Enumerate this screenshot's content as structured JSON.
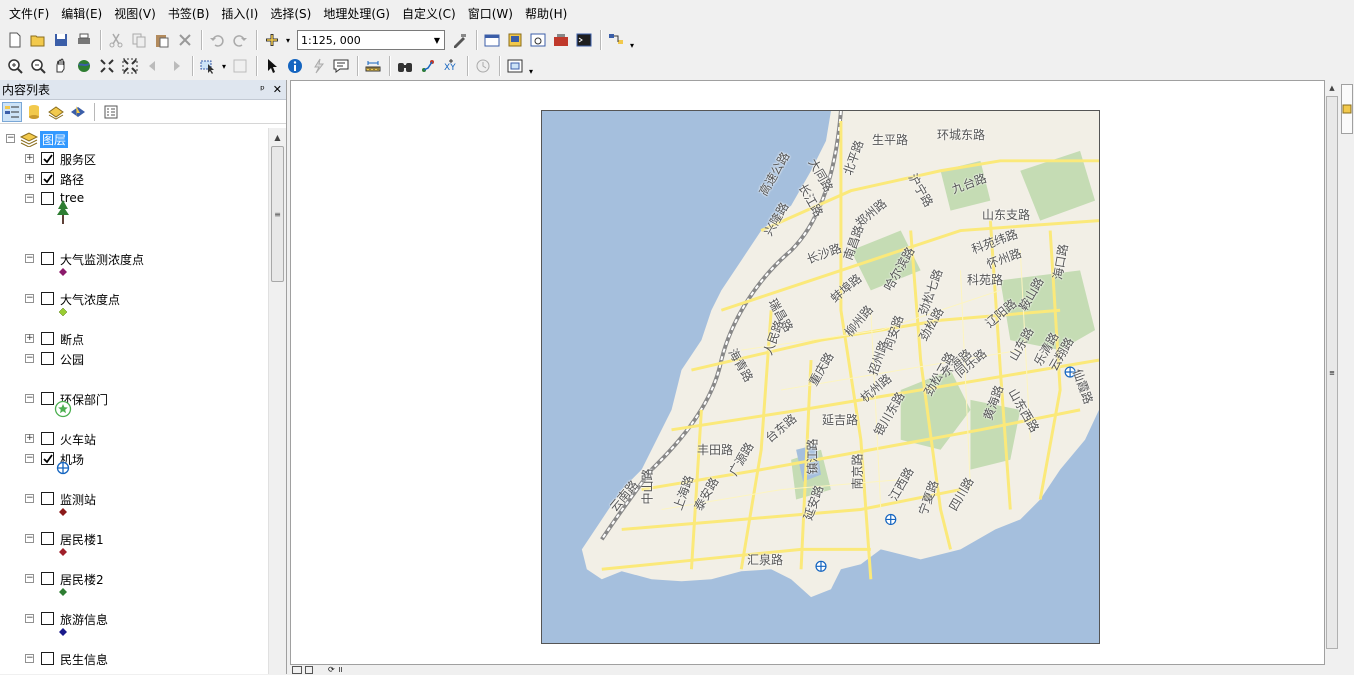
{
  "menubar": {
    "items": [
      "文件(F)",
      "编辑(E)",
      "视图(V)",
      "书签(B)",
      "插入(I)",
      "选择(S)",
      "地理处理(G)",
      "自定义(C)",
      "窗口(W)",
      "帮助(H)"
    ]
  },
  "toolbar": {
    "scale": "1:125, 000",
    "icons_row1": [
      "new-icon",
      "open-icon",
      "save-icon",
      "print-icon",
      "cut-icon",
      "copy-icon",
      "paste-icon",
      "delete-icon",
      "undo-icon",
      "redo-icon",
      "add-data-icon",
      "editor-icon",
      "table-icon",
      "catalog-icon",
      "search-window-icon",
      "arctoolbox-icon",
      "python-icon",
      "model-builder-icon"
    ],
    "icons_row2": [
      "zoom-in-icon",
      "zoom-out-icon",
      "pan-icon",
      "full-extent-icon",
      "fixed-zoom-in-icon",
      "fixed-zoom-out-icon",
      "back-icon",
      "forward-icon",
      "select-features-icon",
      "clear-selection-icon",
      "select-elements-icon",
      "identify-icon",
      "hyperlink-icon",
      "html-popup-icon",
      "measure-icon",
      "find-icon",
      "find-route-icon",
      "goto-xy-icon",
      "time-slider-icon",
      "create-viewer-icon"
    ]
  },
  "toc": {
    "title": "内容列表",
    "pin": "ᵖ",
    "close": "✕",
    "root": "图层",
    "layers": [
      {
        "name": "服务区",
        "checked": true,
        "expander": "+"
      },
      {
        "name": "路径",
        "checked": true,
        "expander": "+"
      },
      {
        "name": "tree",
        "checked": false,
        "expander": "−"
      },
      {
        "name": "大气监测浓度点",
        "checked": false,
        "expander": "−"
      },
      {
        "name": "大气浓度点",
        "checked": false,
        "expander": "−"
      },
      {
        "name": "断点",
        "checked": false,
        "expander": "+"
      },
      {
        "name": "公园",
        "checked": false,
        "expander": "−"
      },
      {
        "name": "环保部门",
        "checked": false,
        "expander": "−"
      },
      {
        "name": "火车站",
        "checked": false,
        "expander": "+"
      },
      {
        "name": "机场",
        "checked": true,
        "expander": "−"
      },
      {
        "name": "监测站",
        "checked": false,
        "expander": "−"
      },
      {
        "name": "居民楼1",
        "checked": false,
        "expander": "−"
      },
      {
        "name": "居民楼2",
        "checked": false,
        "expander": "−"
      },
      {
        "name": "旅游信息",
        "checked": false,
        "expander": "−"
      },
      {
        "name": "民生信息",
        "checked": false,
        "expander": "−"
      }
    ],
    "symbol_colors": {
      "monitor_concentration": "#8b1a6b",
      "concentration": "#9acd32",
      "monitor_station": "#8b1a1a",
      "residential1": "#a0202a",
      "residential2": "#2e7d32",
      "tourism": "#1a1a8b",
      "env_dept": "#4caf50",
      "airport": "#1565c0",
      "tree": "#2e7d32"
    }
  },
  "map": {
    "road_labels": [
      "生平路",
      "环城东路",
      "大同路",
      "长江路",
      "北平路",
      "高速公路",
      "沪宁路",
      "九台路",
      "山东支路",
      "郑州路",
      "兴隆路",
      "长沙路",
      "南昌路",
      "科苑纬路",
      "怀州路",
      "科苑路",
      "瑞昌路",
      "蚌埠路",
      "哈尔滨路",
      "劲松七路",
      "辽阳路",
      "鞍山路",
      "海口路",
      "柳州路",
      "同安路",
      "劲松路",
      "海青路",
      "人民路",
      "东海路",
      "山东路",
      "乐清路",
      "招州路",
      "劲松二路",
      "同乐路",
      "重庆路",
      "延吉路",
      "山东西路",
      "云翔路",
      "仙霞路",
      "杭州路",
      "黄海路",
      "丰田路",
      "台东路",
      "银川东路",
      "广源路",
      "镇江路",
      "中山路",
      "云南路",
      "上海路",
      "泰安路",
      "南京路",
      "江西路",
      "宁夏路",
      "四川路",
      "延安路",
      "汇泉路"
    ],
    "colors": {
      "sea": "#a5bfdd",
      "land": "#f2efe6",
      "road_major": "#fbe97a",
      "park": "#c5dcb4",
      "railway": "#888888"
    }
  }
}
